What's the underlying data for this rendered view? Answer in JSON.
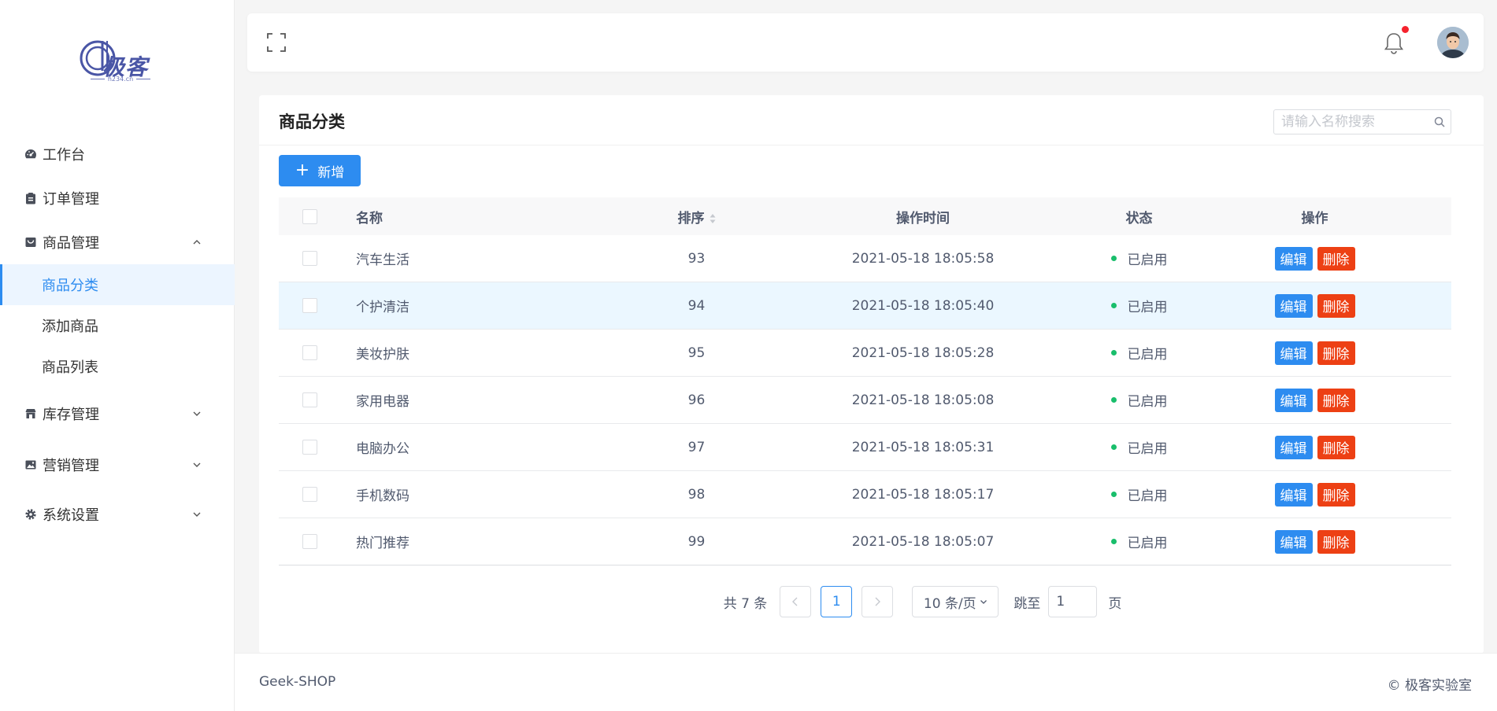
{
  "brand": {
    "logo_text": "极客",
    "logo_sub": "h234.cn"
  },
  "sidebar": {
    "items": [
      {
        "label": "工作台",
        "icon": "dashboard-icon"
      },
      {
        "label": "订单管理",
        "icon": "clipboard-icon"
      },
      {
        "label": "商品管理",
        "icon": "shop-icon",
        "expanded": true,
        "children": [
          {
            "label": "商品分类",
            "active": true
          },
          {
            "label": "添加商品"
          },
          {
            "label": "商品列表"
          }
        ]
      },
      {
        "label": "库存管理",
        "icon": "store-icon"
      },
      {
        "label": "营销管理",
        "icon": "image-icon"
      },
      {
        "label": "系统设置",
        "icon": "gear-icon"
      }
    ]
  },
  "header": {
    "has_notification": true
  },
  "page": {
    "title": "商品分类",
    "search_placeholder": "请输入名称搜索",
    "add_button": "新增"
  },
  "table": {
    "columns": [
      "名称",
      "排序",
      "操作时间",
      "状态",
      "操作"
    ],
    "rows": [
      {
        "name": "汽车生活",
        "sort": "93",
        "time": "2021-05-18 18:05:58",
        "status": "已启用"
      },
      {
        "name": "个护清洁",
        "sort": "94",
        "time": "2021-05-18 18:05:40",
        "status": "已启用"
      },
      {
        "name": "美妆护肤",
        "sort": "95",
        "time": "2021-05-18 18:05:28",
        "status": "已启用"
      },
      {
        "name": "家用电器",
        "sort": "96",
        "time": "2021-05-18 18:05:08",
        "status": "已启用"
      },
      {
        "name": "电脑办公",
        "sort": "97",
        "time": "2021-05-18 18:05:31",
        "status": "已启用"
      },
      {
        "name": "手机数码",
        "sort": "98",
        "time": "2021-05-18 18:05:17",
        "status": "已启用"
      },
      {
        "name": "热门推荐",
        "sort": "99",
        "time": "2021-05-18 18:05:07",
        "status": "已启用"
      }
    ],
    "edit_label": "编辑",
    "delete_label": "删除"
  },
  "pagination": {
    "total_text": "共 7 条",
    "current_page": "1",
    "page_size": "10 条/页",
    "jump_label": "跳至",
    "jump_value": "1",
    "page_label": "页"
  },
  "footer": {
    "left": "Geek-SHOP",
    "right": "© 极客实验室"
  },
  "colors": {
    "primary": "#2d8cf0",
    "danger": "#ed4014",
    "success": "#19be6b",
    "logo": "#4a56a6"
  }
}
